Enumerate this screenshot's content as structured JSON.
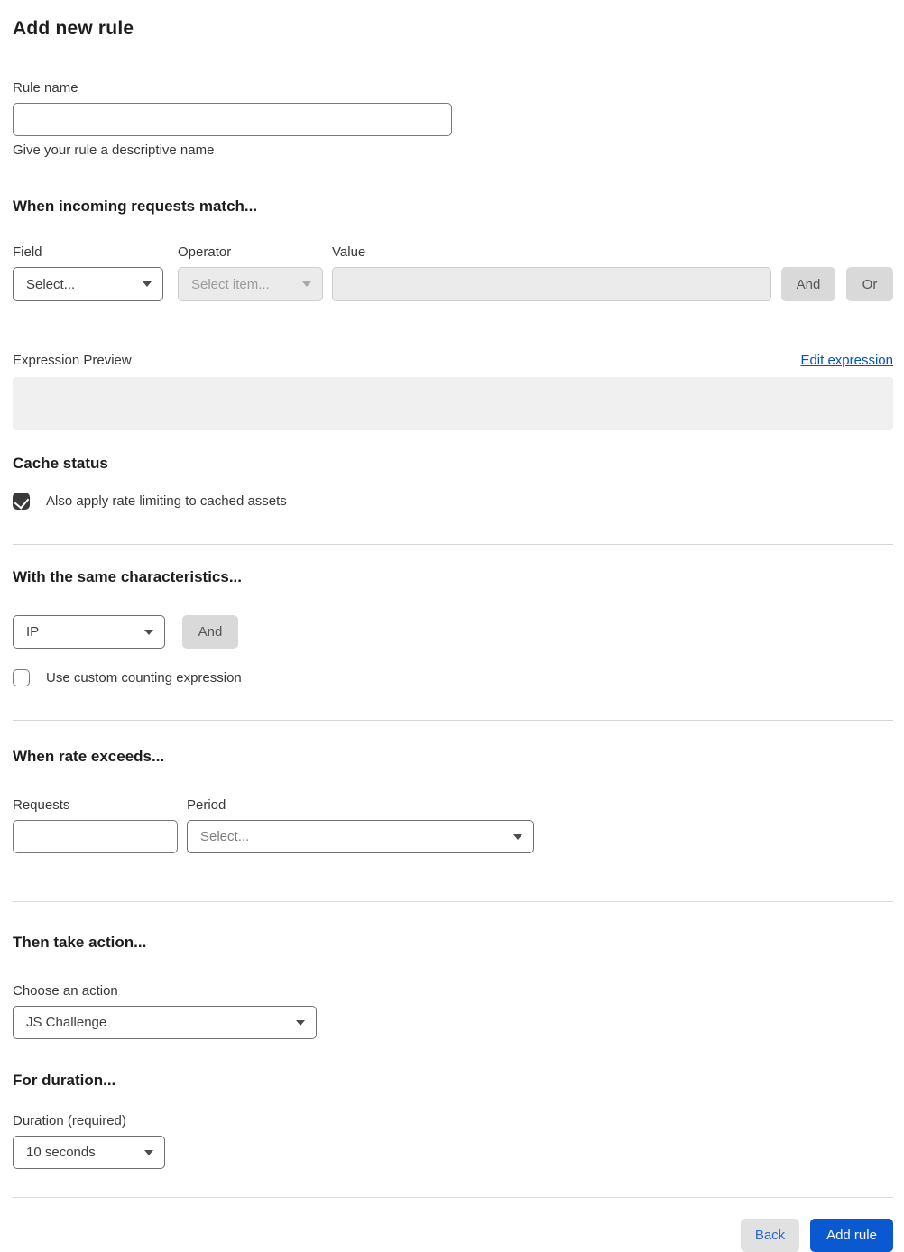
{
  "page": {
    "title": "Add new rule"
  },
  "rule_name": {
    "label": "Rule name",
    "value": "",
    "help": "Give your rule a descriptive name"
  },
  "match": {
    "heading": "When incoming requests match...",
    "field": {
      "label": "Field",
      "selected": "Select..."
    },
    "operator": {
      "label": "Operator",
      "selected": "Select item...",
      "disabled": true
    },
    "value": {
      "label": "Value",
      "value": "",
      "disabled": true
    },
    "and_label": "And",
    "or_label": "Or"
  },
  "expression": {
    "label": "Expression Preview",
    "edit_link": "Edit expression",
    "preview": ""
  },
  "cache": {
    "heading": "Cache status",
    "checkbox_label": "Also apply rate limiting to cached assets",
    "checked": true
  },
  "characteristics": {
    "heading": "With the same characteristics...",
    "selected": "IP",
    "and_label": "And",
    "checkbox_label": "Use custom counting expression",
    "checked": false
  },
  "rate": {
    "heading": "When rate exceeds...",
    "requests": {
      "label": "Requests",
      "value": ""
    },
    "period": {
      "label": "Period",
      "selected": "Select..."
    }
  },
  "action": {
    "heading": "Then take action...",
    "label": "Choose an action",
    "selected": "JS Challenge"
  },
  "duration": {
    "heading": "For duration...",
    "label": "Duration (required)",
    "selected": "10 seconds"
  },
  "footer": {
    "back_label": "Back",
    "submit_label": "Add rule"
  },
  "colors": {
    "primary_blue": "#0a59d1",
    "link_blue": "#0051c3",
    "checkbox_dark": "#3a3a3a",
    "disabled_gray": "#ebebeb"
  }
}
